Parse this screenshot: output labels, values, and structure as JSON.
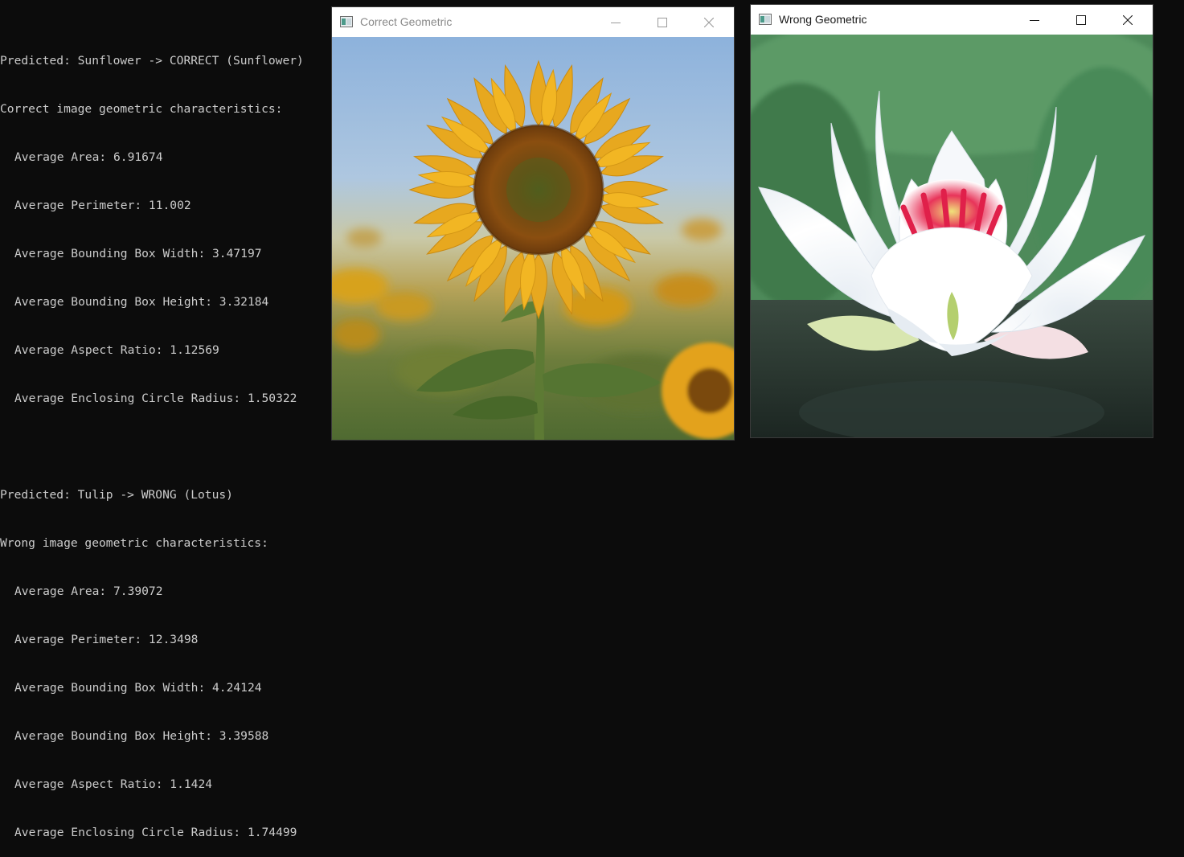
{
  "console": {
    "lines": [
      "Predicted: Sunflower -> CORRECT (Sunflower)",
      "Correct image geometric characteristics:",
      "Average Area: 6.91674",
      "Average Perimeter: 11.002",
      "Average Bounding Box Width: 3.47197",
      "Average Bounding Box Height: 3.32184",
      "Average Aspect Ratio: 1.12569",
      "Average Enclosing Circle Radius: 1.50322",
      "",
      "Predicted: Tulip -> WRONG (Lotus)",
      "Wrong image geometric characteristics:",
      "Average Area: 7.39072",
      "Average Perimeter: 12.3498",
      "Average Bounding Box Width: 4.24124",
      "Average Bounding Box Height: 3.39588",
      "Average Aspect Ratio: 1.1424",
      "Average Enclosing Circle Radius: 1.74499"
    ]
  },
  "windows": {
    "correct": {
      "title": "Correct Geometric",
      "state": "inactive",
      "image": "sunflower"
    },
    "wrong": {
      "title": "Wrong Geometric",
      "state": "active",
      "image": "lotus"
    }
  },
  "icons": {
    "minimize": "minimize-icon",
    "maximize": "maximize-icon",
    "close": "close-icon"
  },
  "colors": {
    "console_bg": "#0c0c0c",
    "console_text": "#cccccc",
    "titlebar_bg": "#ffffff"
  }
}
